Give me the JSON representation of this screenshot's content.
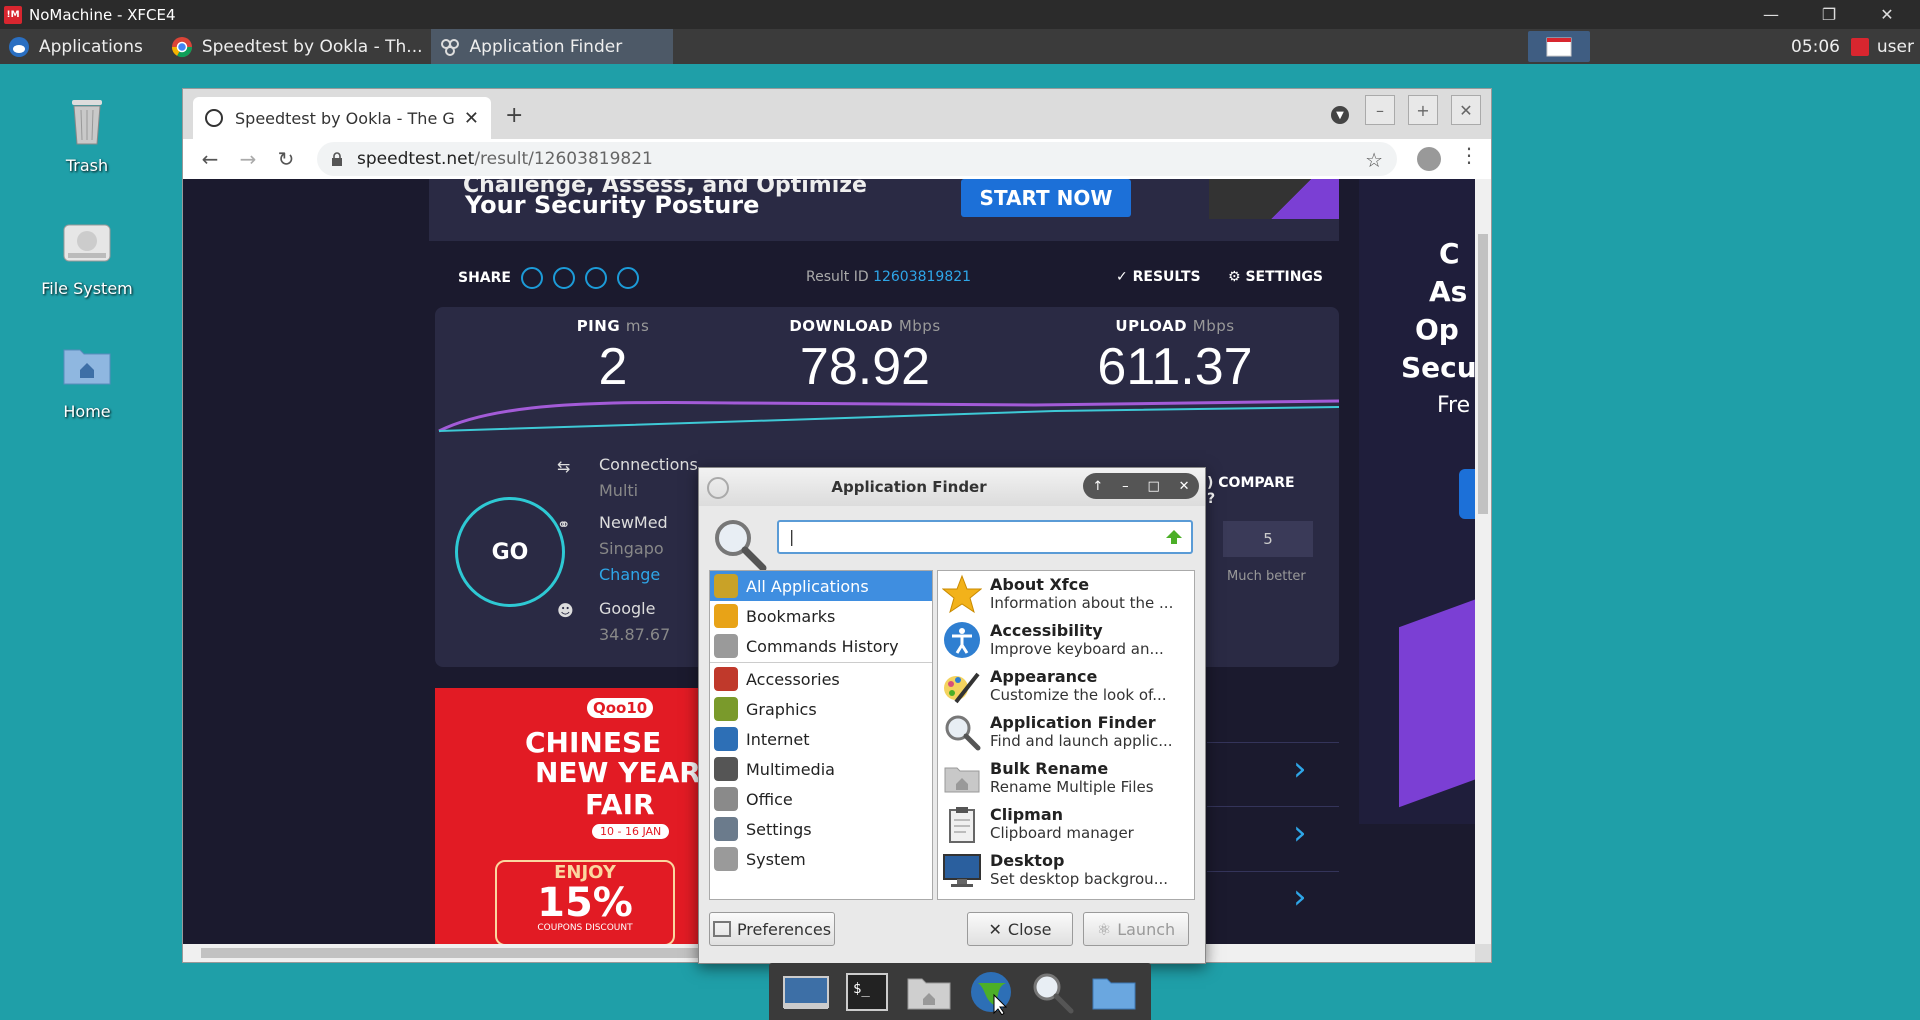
{
  "outer_window": {
    "title": "NoMachine - XFCE4",
    "logo": "!M"
  },
  "panel": {
    "applications": "Applications",
    "task_speedtest": "Speedtest by Ookla - Th...",
    "task_appfinder": "Application Finder",
    "clock": "05:06",
    "user": "user"
  },
  "desktop": {
    "trash": "Trash",
    "file_system": "File System",
    "home": "Home"
  },
  "browser": {
    "tab_title": "Speedtest by Ookla - The G",
    "new_tab": "+",
    "url_domain": "speedtest.net",
    "url_path": "/result/12603819821"
  },
  "speedtest": {
    "ad_top_line1": "Challenge, Assess, and Optimize",
    "ad_top_line2": "Your Security Posture",
    "start_now": "START NOW",
    "share": "SHARE",
    "result_id_label": "Result ID",
    "result_id": "12603819821",
    "results": "RESULTS",
    "settings": "SETTINGS",
    "ping_label": "PING",
    "ping_unit": "ms",
    "ping": "2",
    "download_label": "DOWNLOAD",
    "download_unit": "Mbps",
    "download": "78.92",
    "upload_label": "UPLOAD",
    "upload_unit": "Mbps",
    "upload": "611.37",
    "go": "GO",
    "connections_label": "Connections",
    "connections_value": "Multi",
    "isp": "NewMed",
    "location": "Singapo",
    "change": "Change",
    "host": "Google",
    "ip": "34.87.67",
    "compare": ") COMPARE",
    "compare_q": "?",
    "compare_value": "5",
    "much_better": "Much better",
    "right_ad": [
      "C",
      "As",
      "Op",
      "Secu",
      "Fre"
    ]
  },
  "qoo10_ad": {
    "logo": "Qoo10",
    "line1": "CHINESE",
    "line2": "NEW YEAR",
    "line3": "FAIR",
    "date": "10 - 16 JAN",
    "enjoy": "ENJOY",
    "percent": "15%",
    "coupon": "COUPONS DISCOUNT"
  },
  "appfinder": {
    "title": "Application Finder",
    "search_value": "",
    "categories": [
      {
        "label": "All Applications",
        "icon": "all-apps-icon",
        "color": "#c9a227"
      },
      {
        "label": "Bookmarks",
        "icon": "star-icon",
        "color": "#e8a317"
      },
      {
        "label": "Commands History",
        "icon": "gears-icon",
        "color": "#9a9a9a"
      },
      {
        "label": "Accessories",
        "icon": "accessories-icon",
        "color": "#c0392b"
      },
      {
        "label": "Graphics",
        "icon": "graphics-icon",
        "color": "#7a9a2b"
      },
      {
        "label": "Internet",
        "icon": "globe-icon",
        "color": "#2d6fb6"
      },
      {
        "label": "Multimedia",
        "icon": "multimedia-icon",
        "color": "#555555"
      },
      {
        "label": "Office",
        "icon": "office-icon",
        "color": "#8a8a8a"
      },
      {
        "label": "Settings",
        "icon": "settings-icon",
        "color": "#6b7b8c"
      },
      {
        "label": "System",
        "icon": "system-icon",
        "color": "#9a9a9a"
      }
    ],
    "apps": [
      {
        "name": "About Xfce",
        "desc": "Information about the ...",
        "icon": "star-icon",
        "color": "#f2b21a"
      },
      {
        "name": "Accessibility",
        "desc": "Improve keyboard an...",
        "icon": "accessibility-icon",
        "color": "#2f7fd1"
      },
      {
        "name": "Appearance",
        "desc": "Customize the look of...",
        "icon": "paint-icon",
        "color": "#d94f7a"
      },
      {
        "name": "Application Finder",
        "desc": "Find and launch applic...",
        "icon": "magnifier-icon",
        "color": "#7a7a7a"
      },
      {
        "name": "Bulk Rename",
        "desc": "Rename Multiple Files",
        "icon": "folder-icon",
        "color": "#a0a0a0"
      },
      {
        "name": "Clipman",
        "desc": "Clipboard manager",
        "icon": "clipboard-icon",
        "color": "#6a6a6a"
      },
      {
        "name": "Desktop",
        "desc": "Set desktop backgrou...",
        "icon": "monitor-icon",
        "color": "#2a5f9e"
      }
    ],
    "preferences": "Preferences",
    "close": "Close",
    "launch": "Launch"
  }
}
